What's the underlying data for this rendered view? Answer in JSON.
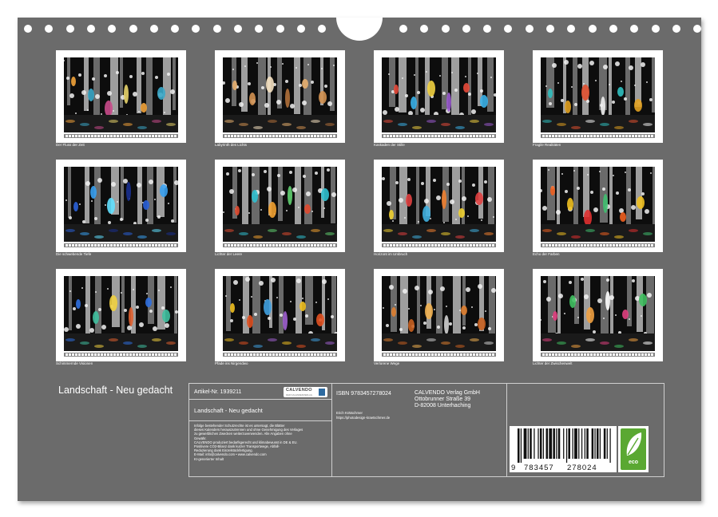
{
  "calendar_title": "Landschaft - Neu gedacht",
  "thumbnails": [
    {
      "caption": "Der Fluss der Zeit"
    },
    {
      "caption": "Labyrinth des Lichts"
    },
    {
      "caption": "Kaskaden der Stille"
    },
    {
      "caption": "Fragile Realitäten"
    },
    {
      "caption": "Die schwebende Tiefe"
    },
    {
      "caption": "Lichter der Leere"
    },
    {
      "caption": "Horizont im Umbruch"
    },
    {
      "caption": "Echo der Farben"
    },
    {
      "caption": "Schimmernde Visionen"
    },
    {
      "caption": "Pfade ins Nirgendwo"
    },
    {
      "caption": "Verlorene Wege"
    },
    {
      "caption": "Lichter der Zwischenwelt"
    }
  ],
  "info": {
    "article_number": "Artikel-Nr. 1939211",
    "title": "Landschaft - Neu gedacht",
    "legal_lines": [
      "Infolge bestehender Schutzrechte ist es untersagt, die Blätter",
      "dieses Kalenders herauszutrennen und ohne Genehmigung des Verlages",
      "zu gewerblichen Zwecken weiterzuverwenden. Alle Angaben ohne",
      "Gewähr.",
      "CALVENDO produziert bedarfsgerecht und klimabewusst in DE & EU.",
      "Positivere CO2-Bilanz dank kurzer Transportwege, Abfall-",
      "Reduzierung dank Einzelstückfertigung.",
      "E-Mail: info@calvendo.com • www.calvendo.com",
      "KI-generierter Inhalt"
    ],
    "isbn": "ISBN 9783457278024",
    "author_name": "Erich Krätschmer",
    "author_url": "https://photodesign-kraetschmer.de",
    "publisher": [
      "CALVENDO Verlag GmbH",
      "Ottobrunner Straße 39",
      "D-82008 Unterhaching"
    ],
    "logo_name": "CALVENDO",
    "logo_sub": "DER KALENDERVERLAG",
    "barcode_digits": [
      "9",
      "783457",
      "278024"
    ],
    "eco_label": "eco"
  },
  "colors": {
    "sheet": "#6b6b6b",
    "eco_green": "#5aa832",
    "logo_blue": "#2d6aa0"
  }
}
